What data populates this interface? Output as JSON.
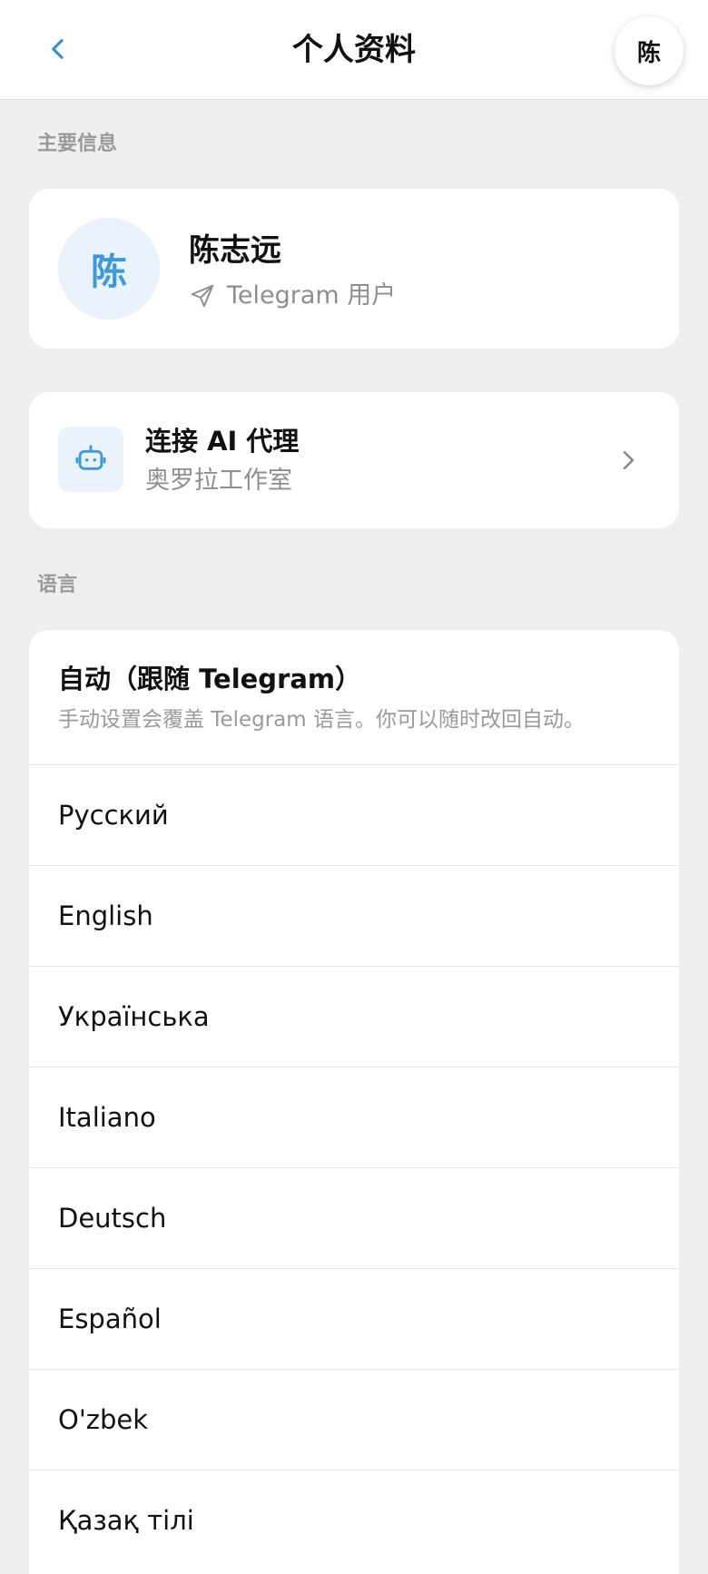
{
  "header": {
    "title": "个人资料",
    "avatar_letter": "陈"
  },
  "main_info": {
    "section_label": "主要信息",
    "avatar_letter": "陈",
    "name": "陈志远",
    "subtitle": "Telegram 用户"
  },
  "agent": {
    "title": "连接 AI 代理",
    "subtitle": "奥罗拉工作室"
  },
  "language": {
    "section_label": "语言",
    "auto_label": "自动（跟随 Telegram）",
    "auto_hint": "手动设置会覆盖 Telegram 语言。你可以随时改回自动。",
    "options": [
      "Русский",
      "English",
      "Українська",
      "Italiano",
      "Deutsch",
      "Español",
      "O'zbek",
      "Қазақ тілі"
    ]
  },
  "colors": {
    "accent": "#3d98dc",
    "background": "#efefef",
    "secondary_text": "#8e8e8e"
  },
  "icons": {
    "back": "chevron-left-icon",
    "send": "send-icon",
    "agent": "robot-icon",
    "chevron": "chevron-right-icon"
  }
}
